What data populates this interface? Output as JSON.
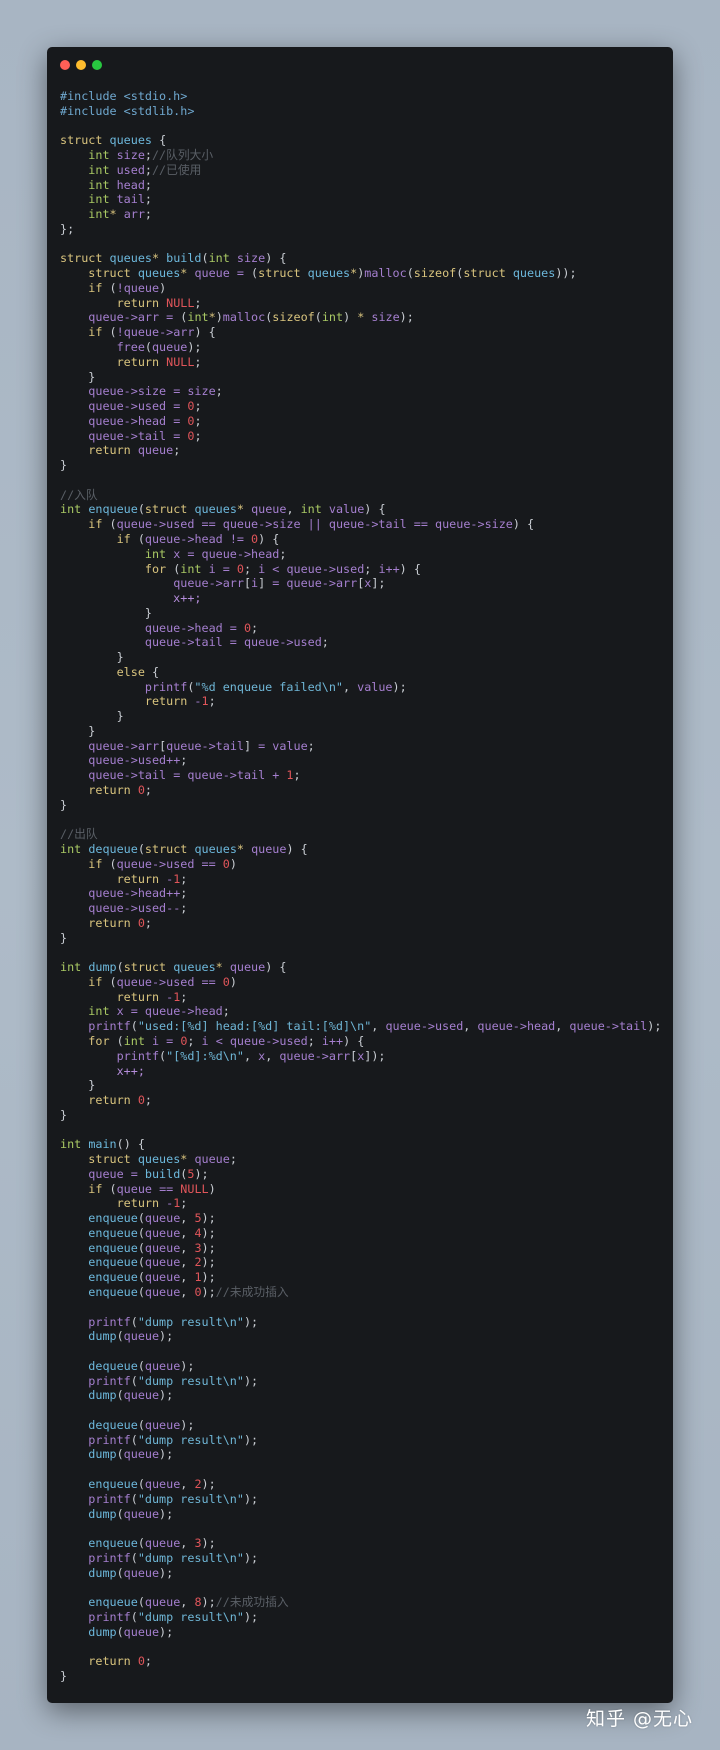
{
  "window": {
    "controls": {
      "close_color": "#ff5f57",
      "minimize_color": "#febc2e",
      "zoom_color": "#28c840"
    },
    "code_lines": [
      "#include <stdio.h>",
      "#include <stdlib.h>",
      "",
      "struct queues {",
      "    int size;//队列大小",
      "    int used;//已使用",
      "    int head;",
      "    int tail;",
      "    int* arr;",
      "};",
      "",
      "struct queues* build(int size) {",
      "    struct queues* queue = (struct queues*)malloc(sizeof(struct queues));",
      "    if (!queue)",
      "        return NULL;",
      "    queue->arr = (int*)malloc(sizeof(int) * size);",
      "    if (!queue->arr) {",
      "        free(queue);",
      "        return NULL;",
      "    }",
      "    queue->size = size;",
      "    queue->used = 0;",
      "    queue->head = 0;",
      "    queue->tail = 0;",
      "    return queue;",
      "}",
      "",
      "//入队",
      "int enqueue(struct queues* queue, int value) {",
      "    if (queue->used == queue->size || queue->tail == queue->size) {",
      "        if (queue->head != 0) {",
      "            int x = queue->head;",
      "            for (int i = 0; i < queue->used; i++) {",
      "                queue->arr[i] = queue->arr[x];",
      "                x++;",
      "            }",
      "            queue->head = 0;",
      "            queue->tail = queue->used;",
      "        }",
      "        else {",
      "            printf(\"%d enqueue failed\\n\", value);",
      "            return -1;",
      "        }",
      "    }",
      "    queue->arr[queue->tail] = value;",
      "    queue->used++;",
      "    queue->tail = queue->tail + 1;",
      "    return 0;",
      "}",
      "",
      "//出队",
      "int dequeue(struct queues* queue) {",
      "    if (queue->used == 0)",
      "        return -1;",
      "    queue->head++;",
      "    queue->used--;",
      "    return 0;",
      "}",
      "",
      "int dump(struct queues* queue) {",
      "    if (queue->used == 0)",
      "        return -1;",
      "    int x = queue->head;",
      "    printf(\"used:[%d] head:[%d] tail:[%d]\\n\", queue->used, queue->head, queue->tail);",
      "    for (int i = 0; i < queue->used; i++) {",
      "        printf(\"[%d]:%d\\n\", x, queue->arr[x]);",
      "        x++;",
      "    }",
      "    return 0;",
      "}",
      "",
      "int main() {",
      "    struct queues* queue;",
      "    queue = build(5);",
      "    if (queue == NULL)",
      "        return -1;",
      "    enqueue(queue, 5);",
      "    enqueue(queue, 4);",
      "    enqueue(queue, 3);",
      "    enqueue(queue, 2);",
      "    enqueue(queue, 1);",
      "    enqueue(queue, 0);//未成功插入",
      "",
      "    printf(\"dump result\\n\");",
      "    dump(queue);",
      "",
      "    dequeue(queue);",
      "    printf(\"dump result\\n\");",
      "    dump(queue);",
      "",
      "    dequeue(queue);",
      "    printf(\"dump result\\n\");",
      "    dump(queue);",
      "",
      "    enqueue(queue, 2);",
      "    printf(\"dump result\\n\");",
      "    dump(queue);",
      "",
      "    enqueue(queue, 3);",
      "    printf(\"dump result\\n\");",
      "    dump(queue);",
      "",
      "    enqueue(queue, 8);//未成功插入",
      "    printf(\"dump result\\n\");",
      "    dump(queue);",
      "",
      "    return 0;",
      "}"
    ]
  },
  "watermark": "知乎 @无心"
}
